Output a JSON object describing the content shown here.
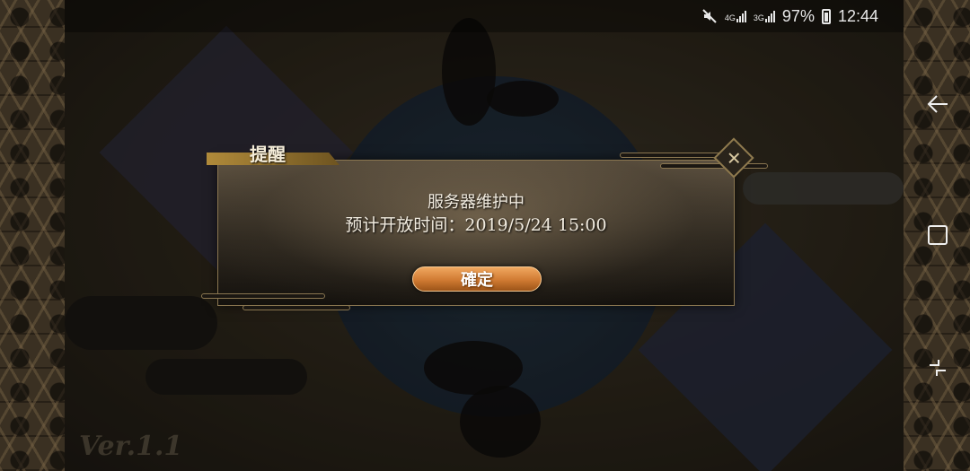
{
  "status_bar": {
    "net_label_1": "4G",
    "net_label_2": "3G",
    "battery": "97%",
    "time": "12:44",
    "icons": [
      "mute-icon",
      "signal-4g-icon",
      "signal-3g-icon",
      "battery-icon"
    ]
  },
  "game": {
    "version": "Ver.1.1"
  },
  "dialog": {
    "title": "提醒",
    "message_line1": "服务器维护中",
    "message_line2": "预计开放时间：2019/5/24 15:00",
    "confirm_label": "確定",
    "close_glyph": "✕"
  },
  "nav_bar": {
    "back_glyph": "←",
    "home_glyph": "▢",
    "recents_glyph": "⌐"
  },
  "colors": {
    "button_accent": "#d07a32",
    "dialog_border": "#8a7650"
  }
}
